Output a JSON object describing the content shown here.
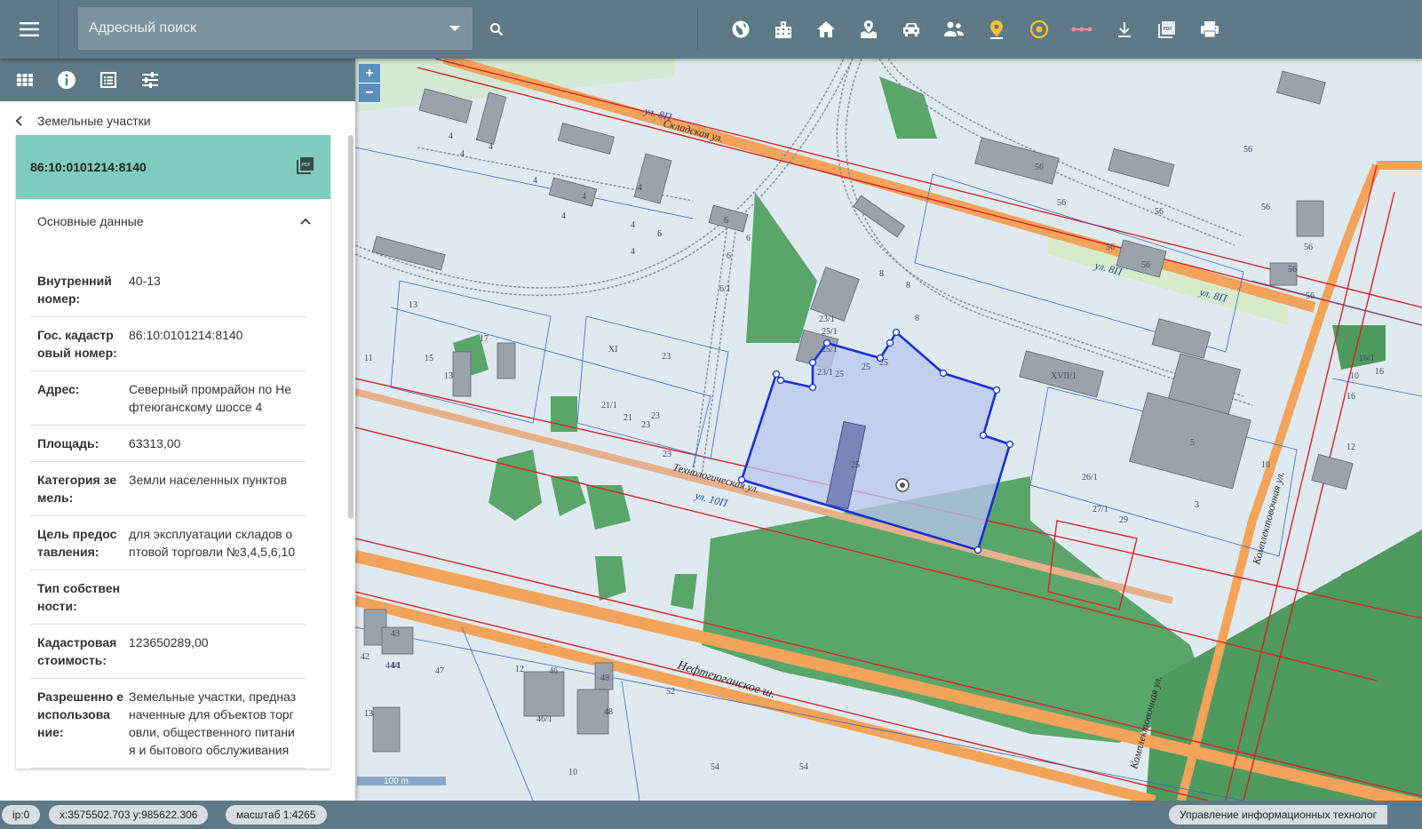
{
  "search": {
    "placeholder": "Адресный поиск"
  },
  "toolbar": {
    "icons": [
      "globe-icon",
      "building-icon",
      "home-icon",
      "landscape-icon",
      "car-icon",
      "people-icon",
      "map-pin-icon",
      "target-icon",
      "measure-icon",
      "download-icon",
      "pdf-icon",
      "print-icon"
    ]
  },
  "panel": {
    "tabs": [
      "grid-icon",
      "info-icon",
      "list-icon",
      "sliders-icon"
    ],
    "breadcrumb": "Земельные участки",
    "card": {
      "cadastral_number": "86:10:0101214:8140",
      "section_title": "Основные данные",
      "rows": [
        {
          "key": "Внутренний номер:",
          "value": "40-13"
        },
        {
          "key": "Гос. кадастр овый номер:",
          "value": "86:10:0101214:8140"
        },
        {
          "key": "Адрес:",
          "value": "Северный промрайон по Не фтеюганскому шоссе 4"
        },
        {
          "key": "Площадь:",
          "value": "63313,00"
        },
        {
          "key": "Категория зе мель:",
          "value": "Земли населенных пунктов"
        },
        {
          "key": "Цель предос тавления:",
          "value": "для эксплуатации складов о птовой торговли №3,4,5,6,10"
        },
        {
          "key": "Тип собствен ности:",
          "value": ""
        },
        {
          "key": "Кадастровая стоимость:",
          "value": "123650289,00"
        },
        {
          "key": "Разрешенно е использова ние:",
          "value": "Земельные участки, предназ наченные для объектов торг овли, общественного питани я и бытового обслуживания"
        }
      ]
    }
  },
  "map": {
    "streets": [
      "ул. 8П",
      "ул. 8П",
      "ул. 8П",
      "Складская ул.",
      "Технологическая ул.",
      "ул. 10П",
      "Нефтеюганское ш.",
      "Комплектовочная ул.",
      "Комплектовочная ул."
    ],
    "block_numbers": [
      "4",
      "4",
      "4",
      "4",
      "4",
      "4",
      "4",
      "4",
      "4",
      "6",
      "6",
      "6",
      "6",
      "6/1",
      "8",
      "8",
      "8",
      "56",
      "56",
      "56",
      "56",
      "56",
      "56",
      "56",
      "56",
      "56",
      "56",
      "25",
      "25",
      "25",
      "25",
      "25/1",
      "25/1",
      "23/1",
      "23/1",
      "23",
      "23",
      "23",
      "23",
      "21",
      "21/1",
      "13",
      "13",
      "17",
      "15",
      "11",
      "XI",
      "XVII/1",
      "10",
      "10",
      "10",
      "5",
      "29",
      "27/1",
      "26/1",
      "3",
      "16",
      "16",
      "16/1",
      "12",
      "43",
      "44",
      "44/1",
      "42",
      "47",
      "46",
      "46/1",
      "48",
      "48",
      "12",
      "13",
      "52",
      "54",
      "54",
      "10"
    ],
    "zoom_in": "+",
    "zoom_out": "−",
    "scale_label": "100 m"
  },
  "status": {
    "ip": "ip:0",
    "coords": "x:3575502.703 y:985622.306",
    "scale": "масштаб 1:4265",
    "org": "Управление информационных технолог"
  },
  "colors": {
    "header": "#5e7a86",
    "card_head": "#7fcbc0",
    "parcel_fill": "#b9c6ef",
    "parcel_stroke": "#1a2fd6",
    "road": "#f3a35a",
    "green": "#5aa56a",
    "boundary_red": "#d8232a"
  }
}
